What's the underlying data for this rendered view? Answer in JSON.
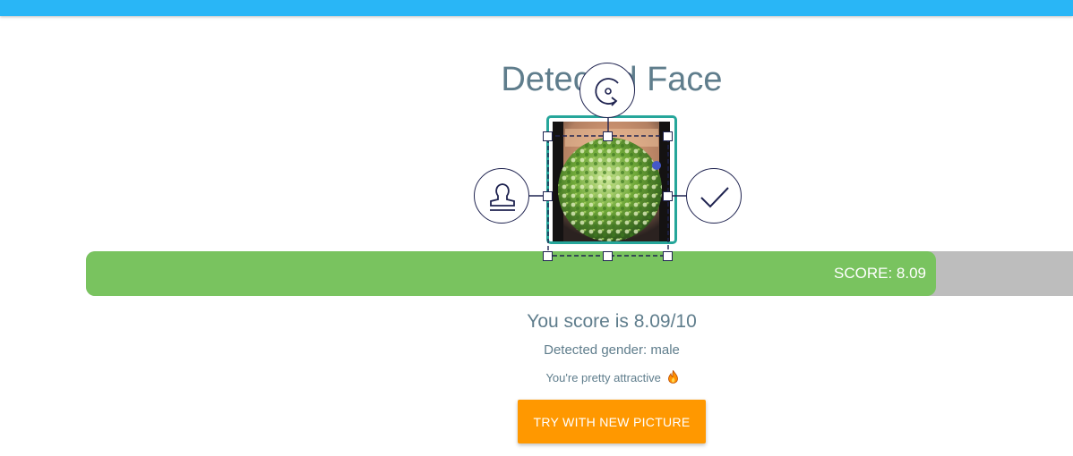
{
  "header": {
    "color": "#29b6f6"
  },
  "page": {
    "title": "Detected Face"
  },
  "face_editor": {
    "frame_color": "#26a69a",
    "tools": [
      {
        "name": "rotate",
        "icon": "rotate-icon"
      },
      {
        "name": "stamp",
        "icon": "stamp-icon"
      },
      {
        "name": "confirm",
        "icon": "checkmark-icon"
      }
    ],
    "handle_color": "#1f2350"
  },
  "score_bar": {
    "label": "SCORE: 8.09",
    "value": 8.09,
    "max": 10,
    "fill_color": "#79c35f",
    "track_color": "#bdbdbd"
  },
  "result": {
    "score_text": "You score is 8.09/10",
    "gender_text": "Detected gender: male",
    "attractiveness_text": "You're pretty attractive",
    "attractiveness_icon": "fire-icon"
  },
  "actions": {
    "try_again_label": "TRY WITH NEW PICTURE",
    "button_color": "#ff9800"
  }
}
